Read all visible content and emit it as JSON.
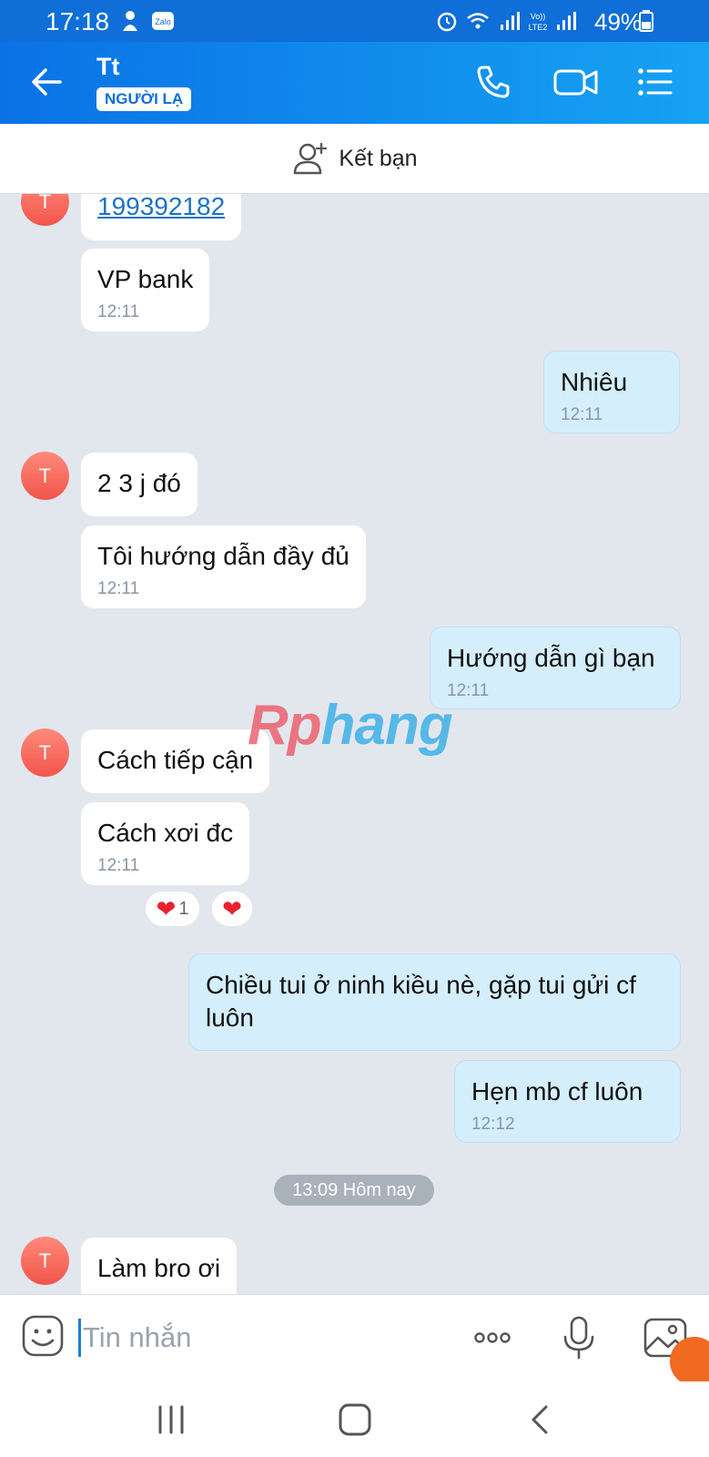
{
  "status_bar": {
    "time": "17:18",
    "battery": "49%",
    "icons": [
      "notification-icon",
      "zalo-icon",
      "alarm-icon",
      "wifi-icon",
      "signal-icon",
      "volte-lte2-icon",
      "signal-icon",
      "battery-icon"
    ]
  },
  "header": {
    "title": "Tt",
    "badge": "NGƯỜI LẠ",
    "actions": [
      "phone-icon",
      "video-call-icon",
      "menu-icon"
    ]
  },
  "add_friend": {
    "label": "Kết bạn"
  },
  "messages": [
    {
      "dir": "in",
      "avatar": "T",
      "text": "199392182",
      "is_link": true,
      "time": ""
    },
    {
      "dir": "in",
      "text": "VP bank",
      "time": "12:11"
    },
    {
      "dir": "out",
      "text": "Nhiêu",
      "time": "12:11"
    },
    {
      "dir": "in",
      "avatar": "T",
      "text": "2 3 j đó",
      "time": ""
    },
    {
      "dir": "in",
      "text": "Tôi hướng dẫn đầy đủ",
      "time": "12:11"
    },
    {
      "dir": "out",
      "text": "Hướng dẫn gì bạn",
      "time": "12:11"
    },
    {
      "dir": "in",
      "avatar": "T",
      "text": "Cách tiếp cận",
      "time": ""
    },
    {
      "dir": "in",
      "text": "Cách xơi đc",
      "time": "12:11",
      "reactions": {
        "count": "1"
      }
    },
    {
      "dir": "out",
      "text": "Chiều tui ở ninh kiều nè, gặp tui gửi cf luôn",
      "time": ""
    },
    {
      "dir": "out",
      "text": "Hẹn mb cf luôn",
      "time": "12:12"
    },
    {
      "dir": "in",
      "avatar": "T",
      "text": "Làm bro ơi",
      "time": ""
    }
  ],
  "day_separator": "13:09 Hôm nay",
  "watermark": {
    "part1": "Rp",
    "part2": "hang"
  },
  "input": {
    "placeholder": "Tin nhắn"
  },
  "input_actions": [
    "emoji-icon",
    "more-icon",
    "microphone-icon",
    "image-icon"
  ],
  "nav": [
    "recent-apps-button",
    "home-button",
    "back-button"
  ],
  "colors": {
    "header_start": "#0a72e6",
    "header_end": "#16a2f2",
    "chat_bg": "#e2e7ee",
    "incoming_bubble": "#ffffff",
    "outgoing_bubble": "#d5eefc",
    "avatar": "#f2554b",
    "heart": "#e8222f"
  }
}
